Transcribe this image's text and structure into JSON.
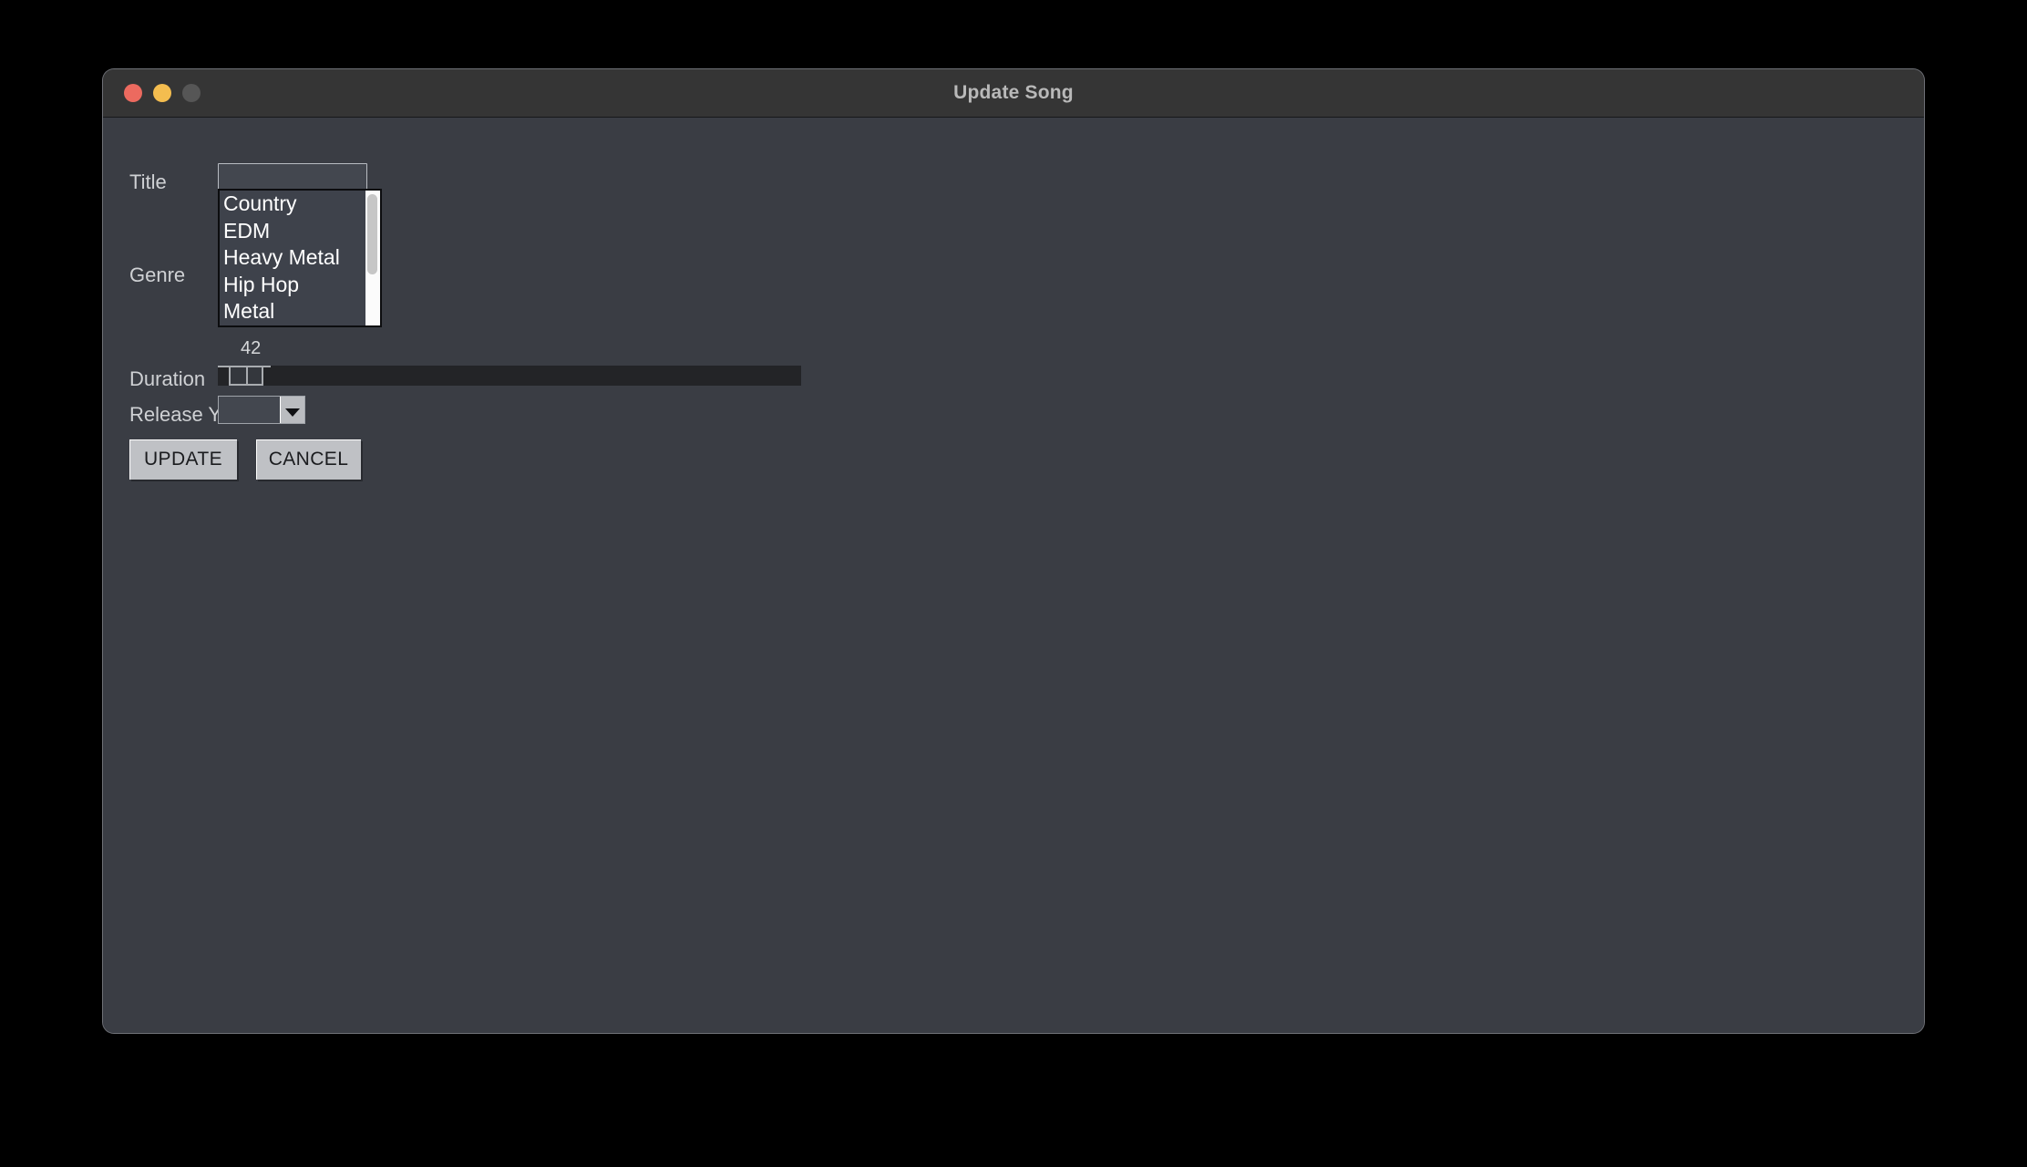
{
  "window": {
    "title": "Update Song",
    "traffic_lights": [
      {
        "name": "close",
        "color": "#ec6a5f"
      },
      {
        "name": "minimize",
        "color": "#f4bd4f"
      },
      {
        "name": "zoom",
        "color": "#565656"
      }
    ],
    "titlebar_color": "#353535",
    "body_color": "#3a3d44"
  },
  "form": {
    "title": {
      "label": "Title",
      "value": "",
      "placeholder": ""
    },
    "genre": {
      "label": "Genre",
      "options": [
        "Country",
        "EDM",
        "Heavy Metal",
        "Hip Hop",
        "Metal"
      ],
      "selected": "",
      "list_bg": "#3e424b",
      "scrollbar": {
        "track_color": "#fbfbfb",
        "thumb_color": "#c6c6c6"
      }
    },
    "duration": {
      "label": "Duration",
      "value": "42",
      "track_color": "#232427",
      "thumb_color": "#a9acb0"
    },
    "release_year": {
      "label": "Release Year",
      "value": "",
      "arrow_icon": "chevron-down-icon"
    },
    "buttons": {
      "update": "UPDATE",
      "cancel": "CANCEL",
      "face_color": "#bfc1c5"
    }
  }
}
